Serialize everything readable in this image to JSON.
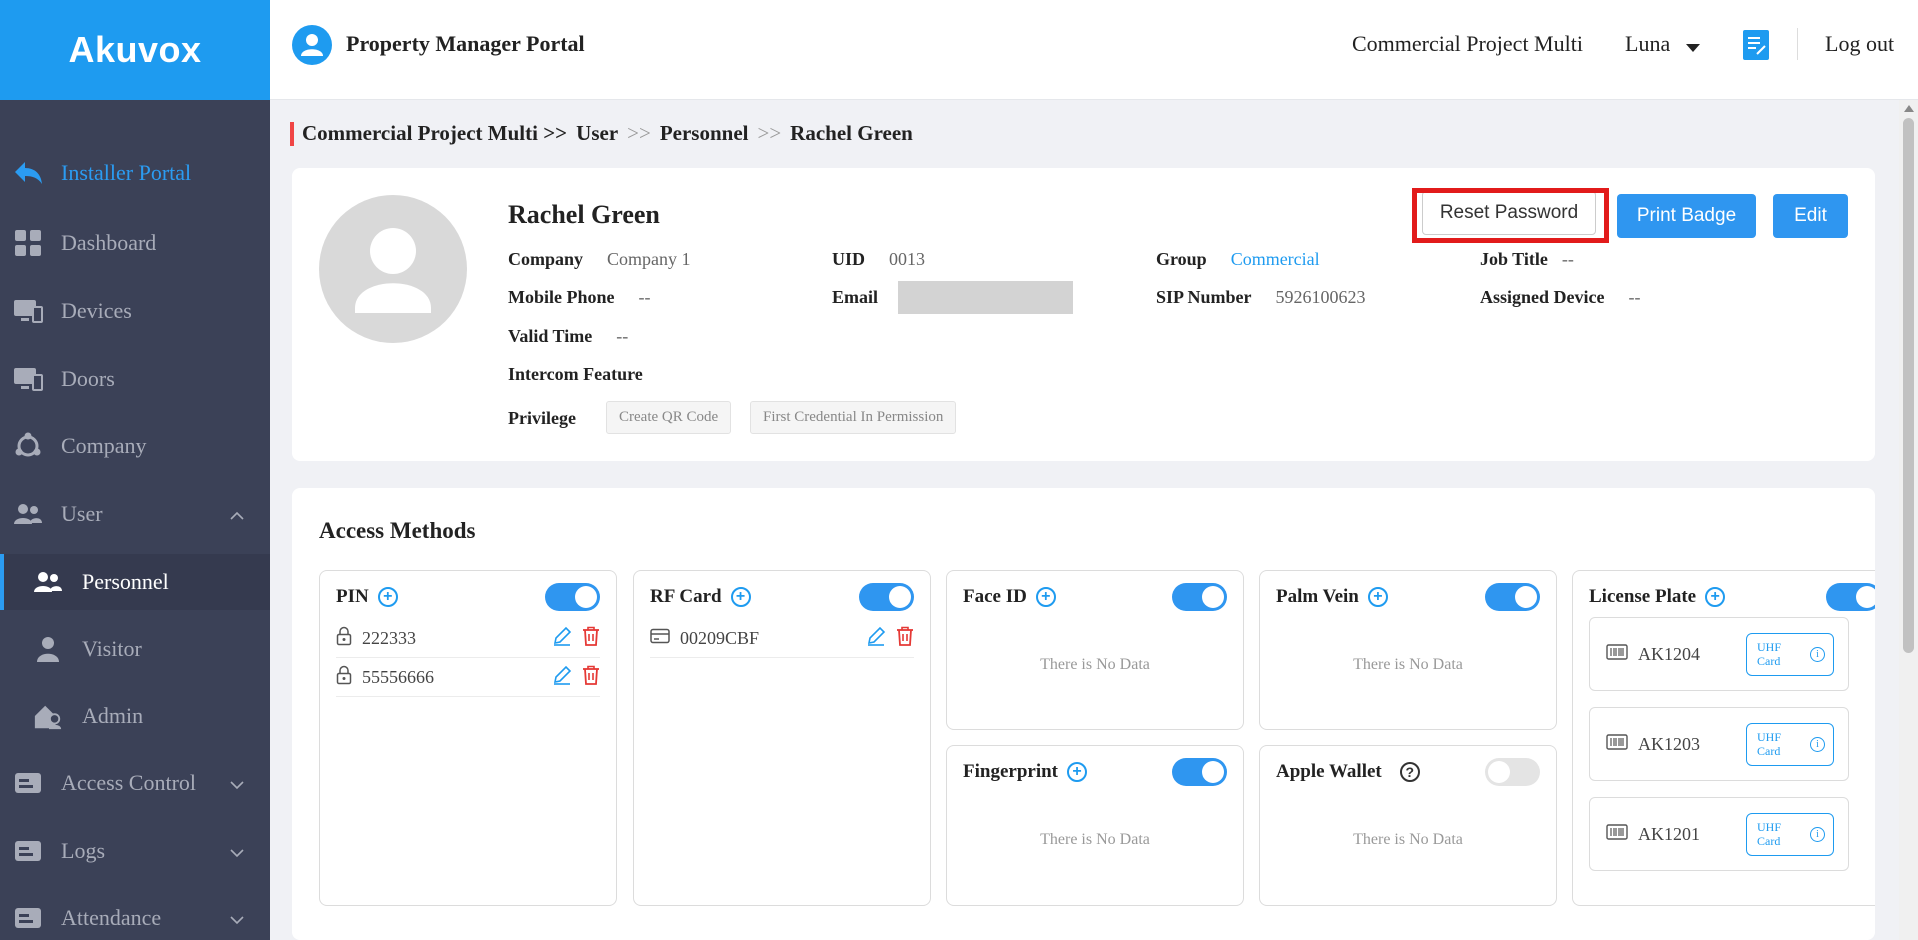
{
  "brand": {
    "logo": "Akuvox",
    "primary_color": "#1e9bf0",
    "sidebar_color": "#3b4157",
    "highlight_color": "#e21b1b"
  },
  "header": {
    "portal_title": "Property Manager Portal",
    "project": "Commercial Project Multi",
    "user": "Luna",
    "logout": "Log out"
  },
  "sidebar": {
    "items": [
      {
        "label": "Installer Portal",
        "icon": "back-arrow-icon"
      },
      {
        "label": "Dashboard",
        "icon": "dashboard-icon"
      },
      {
        "label": "Devices",
        "icon": "devices-icon"
      },
      {
        "label": "Doors",
        "icon": "doors-icon"
      },
      {
        "label": "Company",
        "icon": "company-icon"
      },
      {
        "label": "User",
        "icon": "users-icon"
      },
      {
        "label": "Personnel",
        "icon": "personnel-icon"
      },
      {
        "label": "Visitor",
        "icon": "visitor-icon"
      },
      {
        "label": "Admin",
        "icon": "admin-icon"
      },
      {
        "label": "Access Control",
        "icon": "access-control-icon"
      },
      {
        "label": "Logs",
        "icon": "logs-icon"
      },
      {
        "label": "Attendance",
        "icon": "attendance-icon"
      }
    ]
  },
  "breadcrumb": {
    "project": "Commercial Project Multi >>",
    "user": "User",
    "sep": ">>",
    "personnel": "Personnel",
    "current": "Rachel Green"
  },
  "profile": {
    "name": "Rachel Green",
    "buttons": {
      "reset_password": "Reset Password",
      "print_badge": "Print Badge",
      "edit": "Edit"
    },
    "fields": {
      "company": {
        "label": "Company",
        "value": "Company 1"
      },
      "uid": {
        "label": "UID",
        "value": "0013"
      },
      "group": {
        "label": "Group",
        "value": "Commercial"
      },
      "job_title": {
        "label": "Job Title",
        "value": "--"
      },
      "mobile_phone": {
        "label": "Mobile Phone",
        "value": "--"
      },
      "email": {
        "label": "Email"
      },
      "sip_number": {
        "label": "SIP Number",
        "value": "5926100623"
      },
      "assigned_device": {
        "label": "Assigned Device",
        "value": "--"
      },
      "valid_time": {
        "label": "Valid Time",
        "value": "--"
      },
      "intercom_feature": {
        "label": "Intercom Feature"
      },
      "privilege": {
        "label": "Privilege",
        "tags": [
          "Create QR Code",
          "First Credential In Permission"
        ]
      }
    }
  },
  "access_methods": {
    "title": "Access Methods",
    "no_data": "There is No Data",
    "pin": {
      "title": "PIN",
      "enabled": true,
      "items": [
        "222333",
        "55556666"
      ]
    },
    "rf_card": {
      "title": "RF Card",
      "enabled": true,
      "items": [
        "00209CBF"
      ]
    },
    "face_id": {
      "title": "Face ID",
      "enabled": true
    },
    "palm_vein": {
      "title": "Palm Vein",
      "enabled": true
    },
    "fingerprint": {
      "title": "Fingerprint",
      "enabled": true
    },
    "apple_wallet": {
      "title": "Apple Wallet",
      "enabled": false
    },
    "license_plate": {
      "title": "License Plate",
      "enabled": true,
      "plates": [
        {
          "value": "AK1204",
          "tag_line1": "UHF",
          "tag_line2": "Card"
        },
        {
          "value": "AK1203",
          "tag_line1": "UHF",
          "tag_line2": "Card"
        },
        {
          "value": "AK1201",
          "tag_line1": "UHF",
          "tag_line2": "Card"
        }
      ]
    }
  }
}
